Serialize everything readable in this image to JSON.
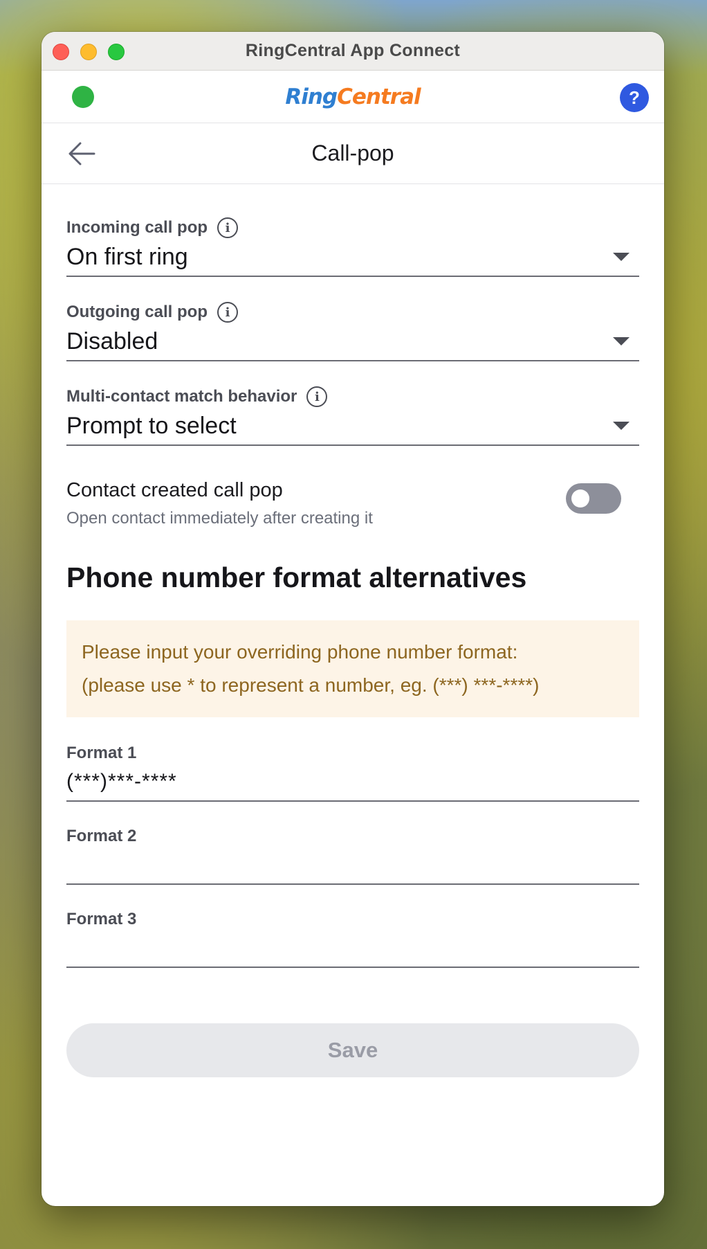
{
  "window": {
    "title": "RingCentral App Connect"
  },
  "header": {
    "logo_ring": "Ring",
    "logo_central": "Central",
    "help_label": "?"
  },
  "page": {
    "title": "Call-pop"
  },
  "fields": {
    "incoming": {
      "label": "Incoming call pop",
      "value": "On first ring"
    },
    "outgoing": {
      "label": "Outgoing call pop",
      "value": "Disabled"
    },
    "multi": {
      "label": "Multi-contact match behavior",
      "value": "Prompt to select"
    }
  },
  "toggle": {
    "title": "Contact created call pop",
    "subtitle": "Open contact immediately after creating it",
    "enabled": false
  },
  "phone_formats": {
    "section_title": "Phone number format alternatives",
    "notice_line1": "Please input your overriding phone number format:",
    "notice_line2": "(please use * to represent a number, eg. (***) ***-****)",
    "format1": {
      "label": "Format 1",
      "value": "(***)***-****"
    },
    "format2": {
      "label": "Format 2",
      "value": ""
    },
    "format3": {
      "label": "Format 3",
      "value": ""
    }
  },
  "actions": {
    "save_label": "Save"
  },
  "colors": {
    "status_dot": "#2fb344",
    "help_button": "#2f59e0",
    "logo_blue": "#2f7fd1",
    "logo_orange": "#f57b20",
    "notice_bg": "#fdf4e7",
    "notice_text": "#8d6620"
  }
}
